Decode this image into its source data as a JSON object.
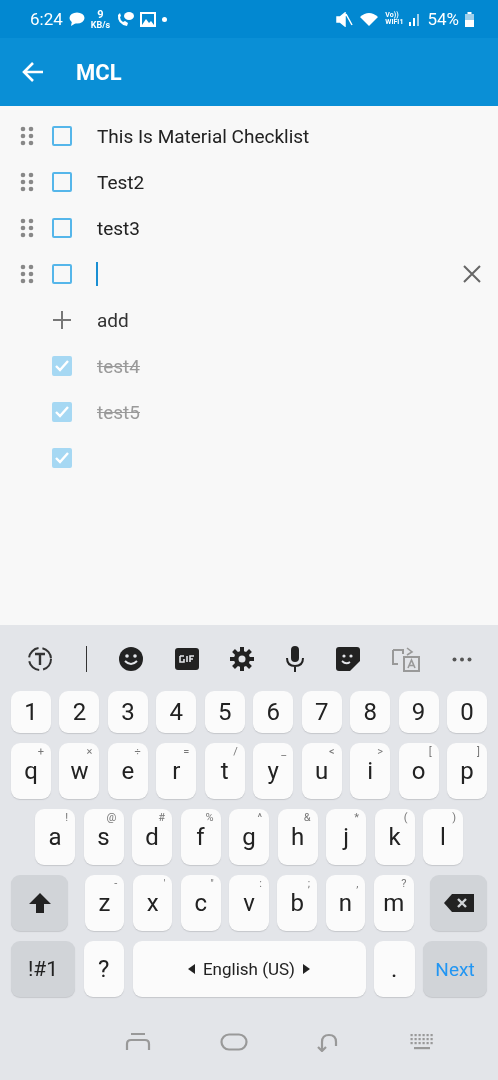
{
  "status_bar": {
    "time": "6:24",
    "speed_value": "9",
    "speed_unit": "KB/s",
    "volte_label": "Vo))",
    "wifi_label": "WIFI1",
    "battery": "54%"
  },
  "app_bar": {
    "title": "MCL"
  },
  "items": [
    {
      "text": "This Is Material Checklist",
      "checked": false,
      "editing": false
    },
    {
      "text": "Test2",
      "checked": false,
      "editing": false
    },
    {
      "text": "test3",
      "checked": false,
      "editing": false
    },
    {
      "checked": false,
      "editing": true
    },
    {
      "kind": "add",
      "text": "add"
    },
    {
      "text": "test4",
      "checked": true,
      "editing": false
    },
    {
      "text": "test5",
      "checked": true,
      "editing": false
    },
    {
      "checked": true,
      "editing": false
    }
  ],
  "keyboard": {
    "rows": [
      {
        "keys": [
          {
            "kind": "char",
            "label": "1"
          },
          {
            "kind": "char",
            "label": "2"
          },
          {
            "kind": "char",
            "label": "3"
          },
          {
            "kind": "char",
            "label": "4"
          },
          {
            "kind": "char",
            "label": "5"
          },
          {
            "kind": "char",
            "label": "6"
          },
          {
            "kind": "char",
            "label": "7"
          },
          {
            "kind": "char",
            "label": "8"
          },
          {
            "kind": "char",
            "label": "9"
          },
          {
            "kind": "char",
            "label": "0"
          }
        ]
      },
      {
        "keys": [
          {
            "kind": "char",
            "label": "q",
            "hint": "+"
          },
          {
            "kind": "char",
            "label": "w",
            "hint": "×"
          },
          {
            "kind": "char",
            "label": "e",
            "hint": "÷"
          },
          {
            "kind": "char",
            "label": "r",
            "hint": "="
          },
          {
            "kind": "char",
            "label": "t",
            "hint": "/"
          },
          {
            "kind": "char",
            "label": "y",
            "hint": "_"
          },
          {
            "kind": "char",
            "label": "u",
            "hint": "<"
          },
          {
            "kind": "char",
            "label": "i",
            "hint": ">"
          },
          {
            "kind": "char",
            "label": "o",
            "hint": "["
          },
          {
            "kind": "char",
            "label": "p",
            "hint": "]"
          }
        ]
      },
      {
        "keys": [
          {
            "kind": "char",
            "label": "a",
            "hint": "!"
          },
          {
            "kind": "char",
            "label": "s",
            "hint": "@"
          },
          {
            "kind": "char",
            "label": "d",
            "hint": "#"
          },
          {
            "kind": "char",
            "label": "f",
            "hint": "%"
          },
          {
            "kind": "char",
            "label": "g",
            "hint": "^"
          },
          {
            "kind": "char",
            "label": "h",
            "hint": "&"
          },
          {
            "kind": "char",
            "label": "j",
            "hint": "*"
          },
          {
            "kind": "char",
            "label": "k",
            "hint": "("
          },
          {
            "kind": "char",
            "label": "l",
            "hint": ")"
          }
        ]
      },
      {
        "keys": [
          {
            "kind": "shift"
          },
          {
            "kind": "char",
            "label": "z",
            "hint": "-"
          },
          {
            "kind": "char",
            "label": "x",
            "hint": "'"
          },
          {
            "kind": "char",
            "label": "c",
            "hint": "\""
          },
          {
            "kind": "char",
            "label": "v",
            "hint": ":"
          },
          {
            "kind": "char",
            "label": "b",
            "hint": ";"
          },
          {
            "kind": "char",
            "label": "n",
            "hint": ","
          },
          {
            "kind": "char",
            "label": "m",
            "hint": "?"
          },
          {
            "kind": "backspace"
          }
        ]
      },
      {
        "keys": [
          {
            "kind": "symbols",
            "label": "!#1"
          },
          {
            "kind": "char",
            "label": "?"
          },
          {
            "kind": "space",
            "label": "English (US)"
          },
          {
            "kind": "char",
            "label": "."
          },
          {
            "kind": "action",
            "label": "Next"
          }
        ]
      }
    ]
  }
}
